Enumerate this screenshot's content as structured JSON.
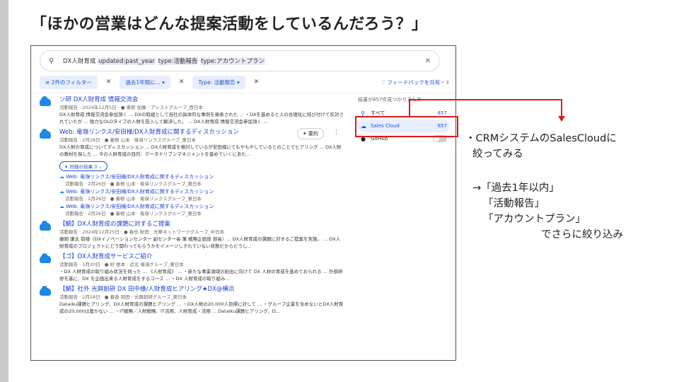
{
  "slide": {
    "title": "「ほかの営業はどんな提案活動をしているんだろう？」"
  },
  "search": {
    "query_plain": "DX人財育成 ",
    "tokens": [
      "updated:past_year",
      "type:活動報告",
      "type:アカウントプラン"
    ]
  },
  "filters": {
    "chips": [
      "≡ 2件のフィルター",
      "過去1年間に... ▾",
      "Type: 活動報告 ▾"
    ],
    "feedback": "♡ フィードバックを共有・⇧"
  },
  "results": [
    {
      "title": "ソ研 DX人財育成 情報交流会",
      "meta": "活動報告 · 2024年12月5日 · ● 車館 加藤 · アシストグループ_西日本",
      "snippet": "DX人財育成 情報交流会参加頂く ... DXの取組として自社の具体的な事例を発表された ... ・DXを進めると人の合理化に結び付けて反対されていたが ... 強力なOLDタイプの人財を投入して解決した。 ... DX人財育成 情報交流会参加頂く ..."
    },
    {
      "title": "Web: 竜嶺リンクス/安田様/DX人財育成に関するディスカッション",
      "meta": "活動報告 · 2月26日 · ● 秦根 山本 · 竜嶺リンクスグループ_東日本",
      "snippet": "DX人財の育成についてディスカッション ... DX人財育成を検討しているが安田様にてもやもやしているとのことでヒアリング ... DX人財の教材を探した ... 今の人財育成の目的：データドリブンマネジメントを進めていくにあた..."
    },
    {
      "title": "【鯛】DX人財育成の課題に対するご提案",
      "meta": "活動報告 · 2024年12月25日 · ● 春也 秋田 · 光華ネットワークグループ_中日本",
      "snippet": "藤岡 謙太 前様（DXイノベーションセンター 副センター長 兼 戦略企画部 部長）... DX人財育成の課題に対するご提案を実施。 ... DX人財育成のプロジェクトにどう関わってもらうかをイメージしきれていない状態だからどうし..."
    },
    {
      "title": "【ゴ】DX人財育成サービスご紹介",
      "meta": "活動報告 · 1月20日 · ● 好 根本 · 近北 竜嶺グループ_東日本",
      "snippet": "・DX 人財育成の取り組み状況を伺った ... 《人財育成》 ... ・新たな事業領域の創出に向けて DX 人材の育成を進めておられる ... 外部研修を基に、DX を企画出来る人財育成をするコース ... ・DX 人財育成の取り組み..."
    },
    {
      "title": "【鯛】社外 光興創研 DX 田中様/人財育成ヒアリング★DX@横浜",
      "meta": "活動報告 · 2月18日 · ● 春香 岡田 · 光興創研グループ_東日本",
      "snippet": "Dataiku課題ヒアリング、DX人財育成の課題ヒアリング ... ・DX人財の20,000人目標に対して ... ・グループ企業を含めないとDX人財育成の20,000は届かない ... ・IT戦略／人財戦略、IT活用、人財育成・活用 ... Dataiku課題ヒアリング、D..."
    }
  ],
  "summarize_label": "✦ 要約",
  "similar_label": "✦ 同様の結果 3 ⌄",
  "sub_results": [
    {
      "title": "Web: 竜嶺リンクス/安田様/DX人財育成に関するディスカッション",
      "meta": "活動報告 · 2月26日 · ● 秦根 山本 · 竜嶺リンクスグループ_東日本"
    },
    {
      "title": "Web: 竜嶺リンクス/安田様/DX人財育成に関するディスカッション",
      "meta": "活動報告 · 2月26日 · ● 秦根 山本 · 竜嶺リンクスグループ_東日本"
    },
    {
      "title": "Web: 竜嶺リンクス/安田様/DX人財育成に関するディスカッション",
      "meta": "活動報告 · 2月26日 · ● 秦根 山本 · 竜嶺リンクスグループ_東日本"
    }
  ],
  "sidebar": {
    "count_text": "結果が857件見つかりました",
    "sources": [
      {
        "label": "すべて",
        "count": "857"
      },
      {
        "label": "Sales Cloud",
        "count": "857"
      },
      {
        "label": "GitHub",
        "count": ""
      }
    ]
  },
  "annotations": {
    "line1": "・CRMシステムのSalesCloudに",
    "line2": "絞ってみる",
    "line3": "→「過去1年以内」",
    "line4": "「活動報告」",
    "line5": "「アカウントプラン」",
    "line6": "でさらに絞り込み"
  },
  "colors": {
    "highlight_red": "#e01818",
    "link_blue": "#1a3fd0",
    "chip_bg": "#e8eefc"
  }
}
